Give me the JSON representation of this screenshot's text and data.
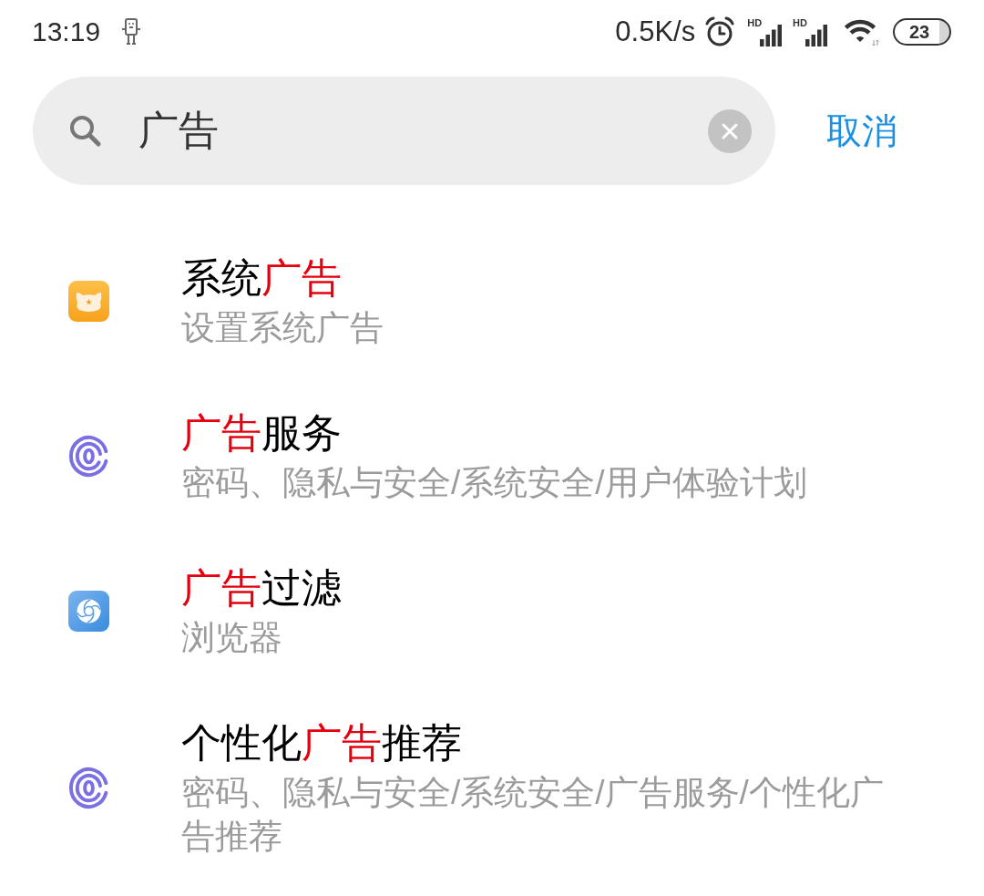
{
  "status_bar": {
    "time": "13:19",
    "net_speed": "0.5K/s",
    "signals": [
      {
        "label": "HD"
      },
      {
        "label": "HD"
      }
    ],
    "battery": "23"
  },
  "search": {
    "value": "广告",
    "cancel": "取消"
  },
  "results": [
    {
      "kind": "system",
      "title": [
        {
          "text": "系统",
          "highlight": false
        },
        {
          "text": "广告",
          "highlight": true
        }
      ],
      "subtitle": "设置系统广告"
    },
    {
      "kind": "privacy",
      "title": [
        {
          "text": "广告",
          "highlight": true
        },
        {
          "text": "服务",
          "highlight": false
        }
      ],
      "subtitle": "密码、隐私与安全/系统安全/用户体验计划"
    },
    {
      "kind": "browser",
      "title": [
        {
          "text": "广告",
          "highlight": true
        },
        {
          "text": "过滤",
          "highlight": false
        }
      ],
      "subtitle": "浏览器"
    },
    {
      "kind": "privacy",
      "title": [
        {
          "text": "个性化",
          "highlight": false
        },
        {
          "text": "广告",
          "highlight": true
        },
        {
          "text": "推荐",
          "highlight": false
        }
      ],
      "subtitle": "密码、隐私与安全/系统安全/广告服务/个性化广告推荐"
    }
  ]
}
